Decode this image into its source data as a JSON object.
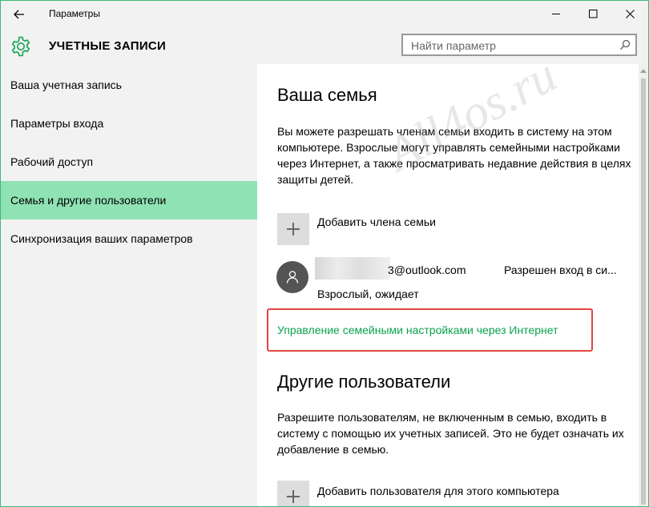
{
  "window": {
    "title": "Параметры"
  },
  "header": {
    "title": "УЧЕТНЫЕ ЗАПИСИ",
    "search_placeholder": "Найти параметр"
  },
  "sidebar": {
    "items": [
      {
        "label": "Ваша учетная запись",
        "active": false
      },
      {
        "label": "Параметры входа",
        "active": false
      },
      {
        "label": "Рабочий доступ",
        "active": false
      },
      {
        "label": "Семья и другие пользователи",
        "active": true
      },
      {
        "label": "Синхронизация ваших параметров",
        "active": false
      }
    ]
  },
  "family": {
    "title": "Ваша семья",
    "description": "Вы можете разрешать членам семьи входить в систему на этом компьютере. Взрослые могут управлять семейными настройками через Интернет, а также просматривать недавние действия в целях защиты детей.",
    "add_label": "Добавить члена семьи",
    "member": {
      "email": "3@outlook.com",
      "status": "Разрешен вход в си...",
      "role": "Взрослый, ожидает"
    },
    "manage_link": "Управление семейными настройками через Интернет"
  },
  "others": {
    "title": "Другие пользователи",
    "description": "Разрешите пользователям, не включенным в семью, входить в систему с помощью их учетных записей. Это не будет означать их добавление в семью.",
    "add_label": "Добавить пользователя для этого компьютера"
  },
  "watermark": "All4os.ru",
  "colors": {
    "accent": "#0aa34d",
    "active_nav": "#8fe2b3",
    "highlight_border": "#e0463f",
    "window_border": "#3cb878"
  },
  "icons": {
    "back": "back-arrow-icon",
    "gear": "gear-icon",
    "search": "search-icon",
    "add": "plus-icon",
    "avatar": "person-icon"
  }
}
